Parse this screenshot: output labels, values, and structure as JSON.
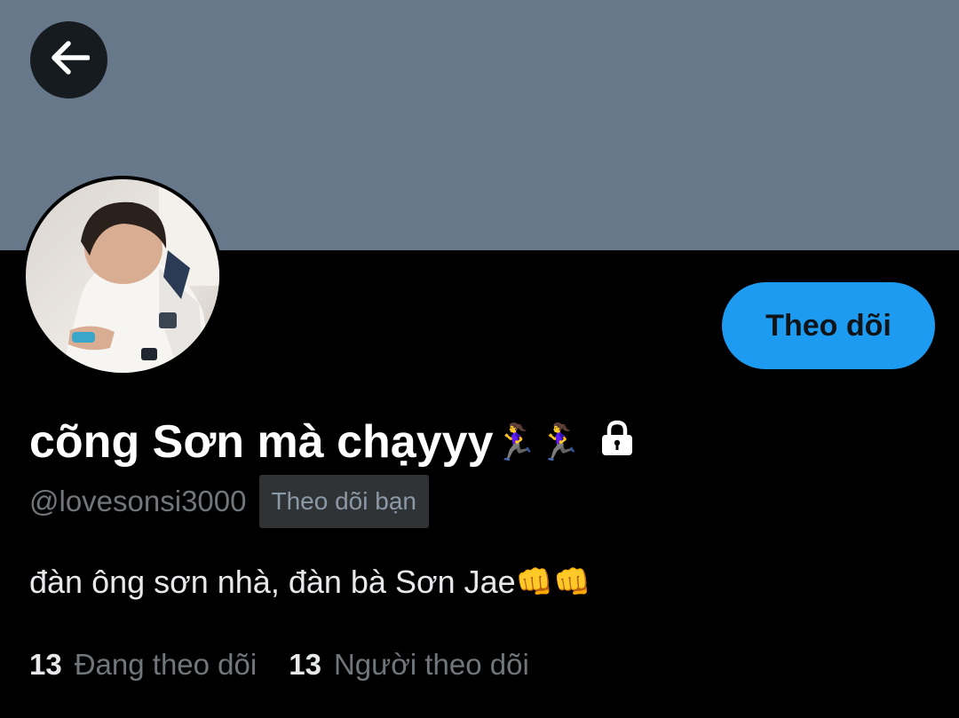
{
  "colors": {
    "banner": "#66788a",
    "background": "#000000",
    "accent": "#1d9bf0",
    "muted_text": "#71767b",
    "primary_text": "#e7e9ea"
  },
  "header": {
    "back_icon": "arrow-left-icon"
  },
  "profile": {
    "avatar_icon": "profile-avatar",
    "follow_button_label": "Theo dõi",
    "display_name": "cõng Sơn mà chạyyy",
    "display_name_emojis": [
      "🏃‍♀️",
      "🏃‍♀️"
    ],
    "protected_icon": "lock-icon",
    "handle": "@lovesonsi3000",
    "follows_you_label": "Theo dõi bạn",
    "bio": "đàn ông sơn nhà, đàn bà Sơn Jae",
    "bio_emojis": [
      "👊",
      "👊"
    ]
  },
  "stats": {
    "following_count": "13",
    "following_label": "Đang theo dõi",
    "followers_count": "13",
    "followers_label": "Người theo dõi"
  }
}
